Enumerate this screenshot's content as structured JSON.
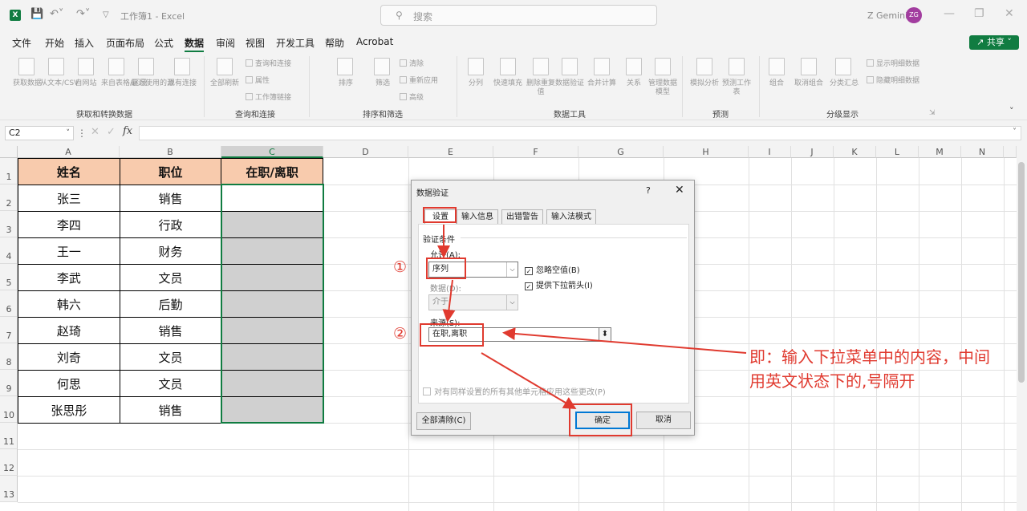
{
  "titlebar": {
    "title": "工作簿1 - Excel",
    "search_placeholder": "搜索",
    "user_name": "Z Gemini",
    "user_initials": "ZG",
    "accent_color": "#107c41"
  },
  "menu": {
    "items": [
      "文件",
      "开始",
      "插入",
      "页面布局",
      "公式",
      "数据",
      "审阅",
      "视图",
      "开发工具",
      "帮助",
      "Acrobat"
    ],
    "active": "数据",
    "share_label": "共享"
  },
  "ribbon": {
    "groups": [
      {
        "label": "获取和转换数据",
        "buttons": [
          "获取数据",
          "从文本/CSV",
          "自网站",
          "来自表格/区域",
          "最近使用的源",
          "现有连接"
        ]
      },
      {
        "label": "查询和连接",
        "buttons": [
          "全部刷新"
        ],
        "small": [
          "查询和连接",
          "属性",
          "工作簿链接"
        ]
      },
      {
        "label": "排序和筛选",
        "buttons": [
          "排序",
          "筛选"
        ],
        "small": [
          "清除",
          "重新应用",
          "高级"
        ]
      },
      {
        "label": "数据工具",
        "buttons": [
          "分列",
          "快速填充",
          "删除重复值",
          "数据验证",
          "合并计算",
          "关系",
          "管理数据模型"
        ]
      },
      {
        "label": "预测",
        "buttons": [
          "模拟分析",
          "预测工作表"
        ]
      },
      {
        "label": "分级显示",
        "buttons": [
          "组合",
          "取消组合",
          "分类汇总"
        ],
        "small": [
          "显示明细数据",
          "隐藏明细数据"
        ]
      }
    ]
  },
  "formula_bar": {
    "name_box": "C2",
    "fx": "fx",
    "value": ""
  },
  "sheet": {
    "columns": [
      "A",
      "B",
      "C",
      "D",
      "E",
      "F",
      "G",
      "H",
      "I",
      "J",
      "K",
      "L",
      "M",
      "N"
    ],
    "rows": [
      "1",
      "2",
      "3",
      "4",
      "5",
      "6",
      "7",
      "8",
      "9",
      "10",
      "11",
      "12",
      "13"
    ],
    "selected_column": "C",
    "headers": [
      "姓名",
      "职位",
      "在职/离职"
    ],
    "data": [
      [
        "张三",
        "销售",
        ""
      ],
      [
        "李四",
        "行政",
        ""
      ],
      [
        "王一",
        "财务",
        ""
      ],
      [
        "李武",
        "文员",
        ""
      ],
      [
        "韩六",
        "后勤",
        ""
      ],
      [
        "赵琦",
        "销售",
        ""
      ],
      [
        "刘奇",
        "文员",
        ""
      ],
      [
        "何思",
        "文员",
        ""
      ],
      [
        "张思彤",
        "销售",
        ""
      ]
    ],
    "header_color": "#f8cbad",
    "selection_color": "#d0d0d0"
  },
  "dialog": {
    "title": "数据验证",
    "help": "?",
    "close": "✕",
    "tabs": [
      "设置",
      "输入信息",
      "出错警告",
      "输入法模式"
    ],
    "active_tab": "设置",
    "section_label": "验证条件",
    "allow_label": "允许(A):",
    "allow_value": "序列",
    "ignore_blank": "忽略空值(B)",
    "dropdown_arrow": "提供下拉箭头(I)",
    "data_label": "数据(D):",
    "data_value": "介于",
    "source_label": "来源(S):",
    "source_value": "在职,离职",
    "apply_all": "对有同样设置的所有其他单元格应用这些更改(P)",
    "clear_all": "全部清除(C)",
    "ok": "确定",
    "cancel": "取消"
  },
  "annotation": {
    "marker_1": "①",
    "marker_2": "②",
    "line_1": "即：输入下拉菜单中的内容，中间",
    "line_2": "用英文状态下的,号隔开",
    "color": "#e03a2f"
  }
}
